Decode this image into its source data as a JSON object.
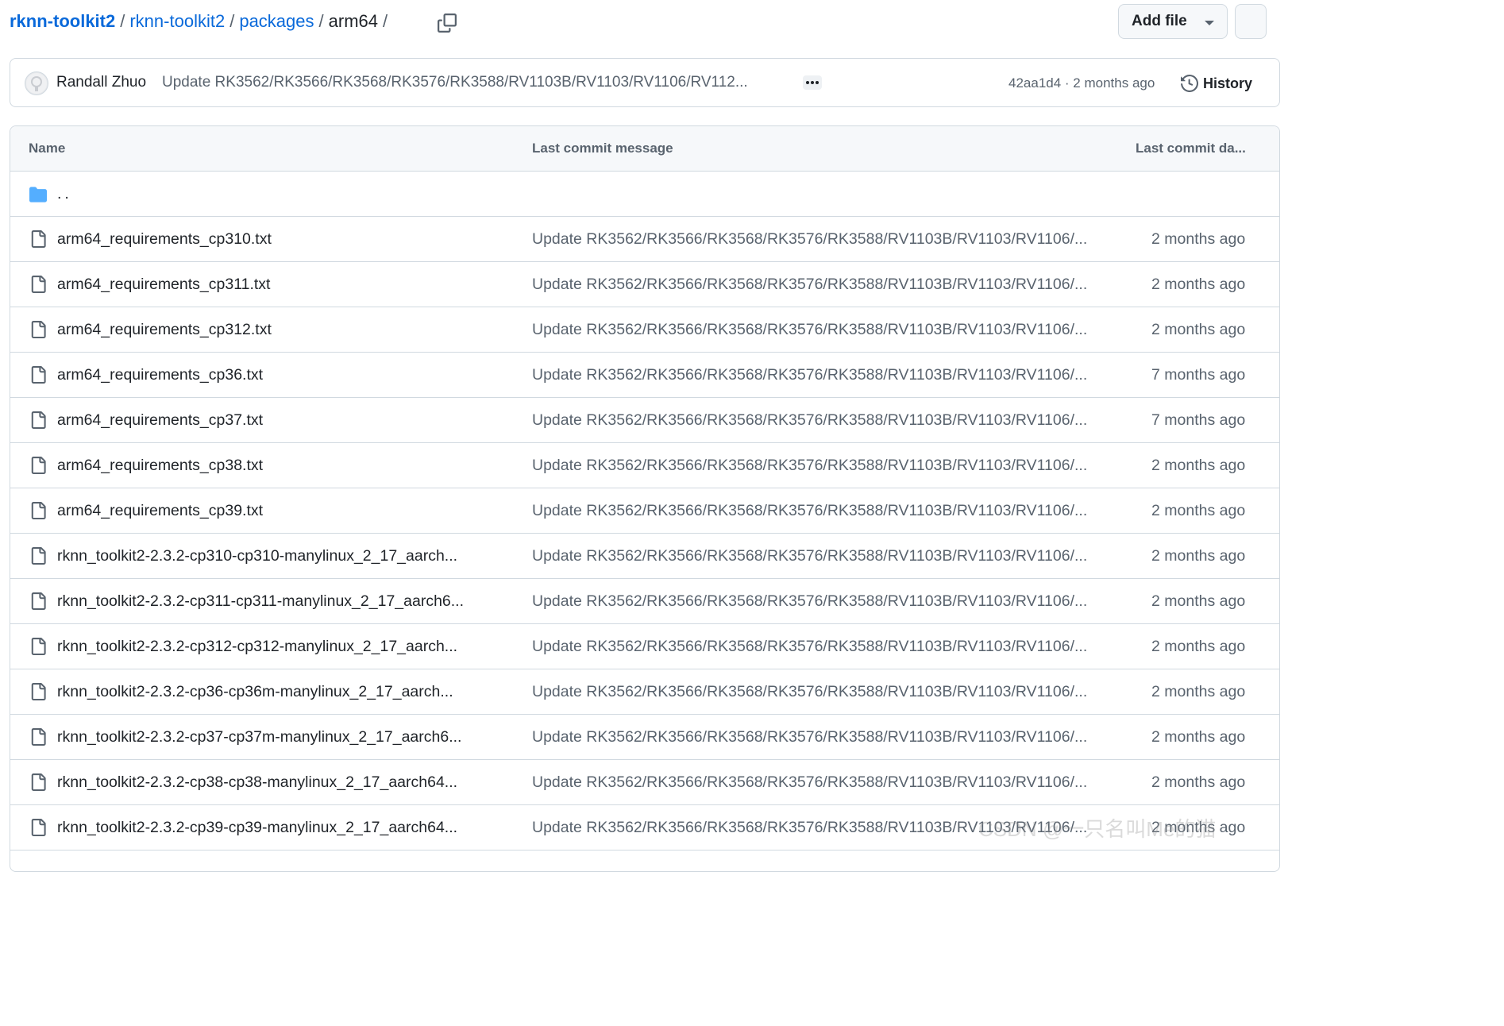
{
  "breadcrumb": {
    "repo": "rknn-toolkit2",
    "path": [
      "rknn-toolkit2",
      "packages"
    ],
    "current": "arm64",
    "separator": "/"
  },
  "toolbar": {
    "add_file_label": "Add file"
  },
  "latest_commit": {
    "author": "Randall Zhuo",
    "message": "Update RK3562/RK3566/RK3568/RK3576/RK3588/RV1103B/RV1103/RV1106/RV112...",
    "sha": "42aa1d4",
    "meta_sep": " · ",
    "age": "2 months ago",
    "history_label": "History"
  },
  "table": {
    "headers": {
      "name": "Name",
      "message": "Last commit message",
      "date": "Last commit da..."
    },
    "parent_dir": "..",
    "rows": [
      {
        "name": "arm64_requirements_cp310.txt",
        "message": "Update RK3562/RK3566/RK3568/RK3576/RK3588/RV1103B/RV1103/RV1106/...",
        "date": "2 months ago"
      },
      {
        "name": "arm64_requirements_cp311.txt",
        "message": "Update RK3562/RK3566/RK3568/RK3576/RK3588/RV1103B/RV1103/RV1106/...",
        "date": "2 months ago"
      },
      {
        "name": "arm64_requirements_cp312.txt",
        "message": "Update RK3562/RK3566/RK3568/RK3576/RK3588/RV1103B/RV1103/RV1106/...",
        "date": "2 months ago"
      },
      {
        "name": "arm64_requirements_cp36.txt",
        "message": "Update RK3562/RK3566/RK3568/RK3576/RK3588/RV1103B/RV1103/RV1106/...",
        "date": "7 months ago"
      },
      {
        "name": "arm64_requirements_cp37.txt",
        "message": "Update RK3562/RK3566/RK3568/RK3576/RK3588/RV1103B/RV1103/RV1106/...",
        "date": "7 months ago"
      },
      {
        "name": "arm64_requirements_cp38.txt",
        "message": "Update RK3562/RK3566/RK3568/RK3576/RK3588/RV1103B/RV1103/RV1106/...",
        "date": "2 months ago"
      },
      {
        "name": "arm64_requirements_cp39.txt",
        "message": "Update RK3562/RK3566/RK3568/RK3576/RK3588/RV1103B/RV1103/RV1106/...",
        "date": "2 months ago"
      },
      {
        "name": "rknn_toolkit2-2.3.2-cp310-cp310-manylinux_2_17_aarch...",
        "message": "Update RK3562/RK3566/RK3568/RK3576/RK3588/RV1103B/RV1103/RV1106/...",
        "date": "2 months ago"
      },
      {
        "name": "rknn_toolkit2-2.3.2-cp311-cp311-manylinux_2_17_aarch6...",
        "message": "Update RK3562/RK3566/RK3568/RK3576/RK3588/RV1103B/RV1103/RV1106/...",
        "date": "2 months ago"
      },
      {
        "name": "rknn_toolkit2-2.3.2-cp312-cp312-manylinux_2_17_aarch...",
        "message": "Update RK3562/RK3566/RK3568/RK3576/RK3588/RV1103B/RV1103/RV1106/...",
        "date": "2 months ago"
      },
      {
        "name": "rknn_toolkit2-2.3.2-cp36-cp36m-manylinux_2_17_aarch...",
        "message": "Update RK3562/RK3566/RK3568/RK3576/RK3588/RV1103B/RV1103/RV1106/...",
        "date": "2 months ago"
      },
      {
        "name": "rknn_toolkit2-2.3.2-cp37-cp37m-manylinux_2_17_aarch6...",
        "message": "Update RK3562/RK3566/RK3568/RK3576/RK3588/RV1103B/RV1103/RV1106/...",
        "date": "2 months ago"
      },
      {
        "name": "rknn_toolkit2-2.3.2-cp38-cp38-manylinux_2_17_aarch64...",
        "message": "Update RK3562/RK3566/RK3568/RK3576/RK3588/RV1103B/RV1103/RV1106/...",
        "date": "2 months ago"
      },
      {
        "name": "rknn_toolkit2-2.3.2-cp39-cp39-manylinux_2_17_aarch64...",
        "message": "Update RK3562/RK3566/RK3568/RK3576/RK3588/RV1103B/RV1103/RV1106/...",
        "date": "2 months ago"
      }
    ]
  },
  "watermark": "CSDN @一只名叫Me的猫",
  "colors": {
    "link": "#0969da",
    "text": "#1f2328",
    "muted": "#59636e",
    "border": "#d1d9e0",
    "folder": "#54aeff",
    "header_bg": "#f6f8fa"
  },
  "icons": {
    "copy": "copy-icon",
    "caret": "triangle-down-icon",
    "ellipsis": "kebab-horizontal-icon",
    "history": "history-clock-icon",
    "folder": "folder-icon",
    "file": "file-icon"
  }
}
